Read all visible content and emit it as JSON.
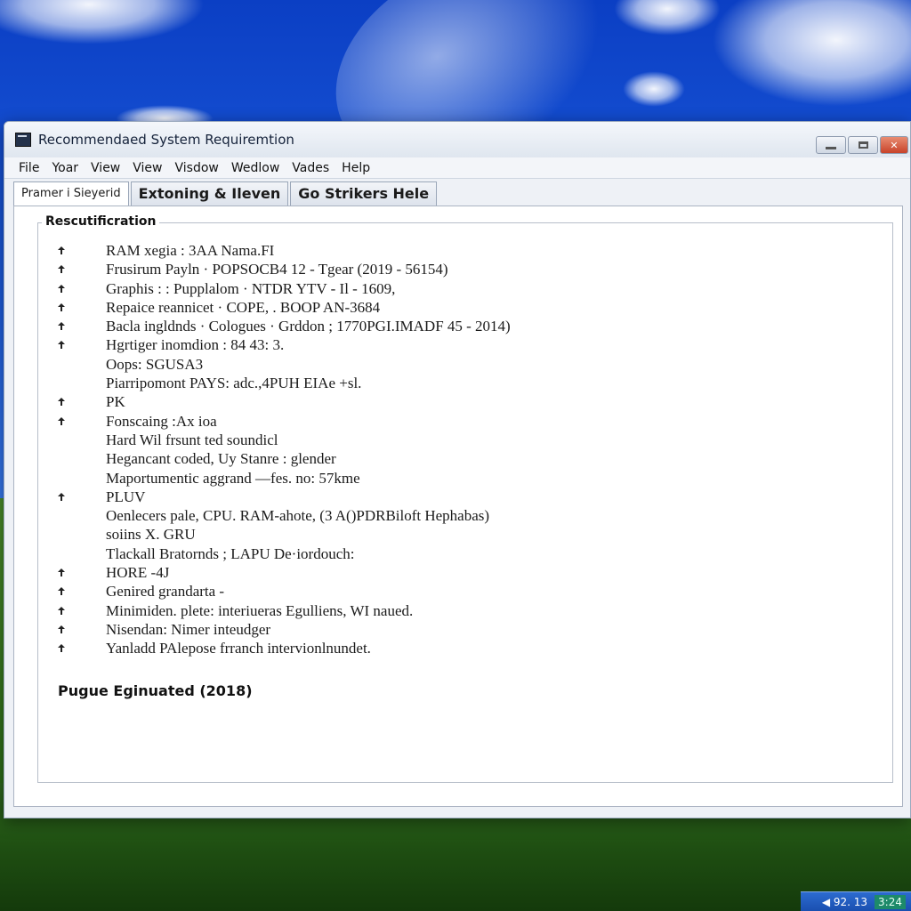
{
  "window": {
    "title": "Recommendaed System Requiremtion",
    "controls": {
      "minimize": "minimize",
      "maximize": "maximize",
      "close": "✕"
    }
  },
  "menu": [
    "File",
    "Yoar",
    "View",
    "View",
    "Visdow",
    "Wedlow",
    "Vades",
    "Help"
  ],
  "tabs": [
    "Pramer i Sieyerid",
    "Extoning & Ileven",
    "Go Strikers Hele"
  ],
  "group": {
    "title": "Rescutificration",
    "items": [
      {
        "bullet": true,
        "text": "RAM xegia : 3AA Nama.FI"
      },
      {
        "bullet": true,
        "text": "Frusirum Payln · POPSOCB4 12 - Tgear (2019 - 56154)"
      },
      {
        "bullet": true,
        "text": "Graphis : : Pupplalom · NTDR YTV - Il - 1609,"
      },
      {
        "bullet": true,
        "text": "Repaice reannicet · COPE, . BOOP AN-3684"
      },
      {
        "bullet": true,
        "text": "Bacla ingldnds · Cologues · Grddon ; 1770PGI.IMADF 45 - 2014)"
      },
      {
        "bullet": true,
        "text": "Hgrtiger inomdion : 84 43: 3."
      },
      {
        "bullet": false,
        "text": "Oops: SGUSA3"
      },
      {
        "bullet": false,
        "text": "Piarripomont PAYS: adc.,4PUH EIAe +sl."
      },
      {
        "bullet": true,
        "text": "PK"
      },
      {
        "bullet": true,
        "text": "Fonscaing :Ax ioa"
      },
      {
        "bullet": false,
        "text": "Hard Wil frsunt ted soundicl"
      },
      {
        "bullet": false,
        "text": "Hegancant coded, Uy Stanre : glender"
      },
      {
        "bullet": false,
        "text": "Maportumentic aggrand —fes. no: 57kme"
      },
      {
        "bullet": true,
        "text": "PLUV"
      },
      {
        "bullet": false,
        "text": "Oenlecers pale, CPU. RAM-ahote, (3 A()PDRBiloft Hephabas)"
      },
      {
        "bullet": false,
        "text": "soiins X. GRU"
      },
      {
        "bullet": false,
        "text": "Tlackall Bratornds ; LAPU De·iordouch:"
      },
      {
        "bullet": true,
        "text": "HORE -4J"
      },
      {
        "bullet": true,
        "text": "Genired grandarta -"
      },
      {
        "bullet": true,
        "text": "Minimiden. plete: interiueras Egulliens, WI naued."
      },
      {
        "bullet": true,
        "text": "Nisendan: Nimer inteudger"
      },
      {
        "bullet": true,
        "text": "Yanladd PAlepose frranch intervionlnundet."
      }
    ],
    "footer": "Pugue Eginuated (2018)"
  },
  "tray": {
    "icons": "◀ 92. 13",
    "clock": "3:24"
  },
  "colors": {
    "sky": "#1f5fe0",
    "grass": "#1f4f12",
    "window_bg": "#eef1f6",
    "close_button": "#c8432a"
  }
}
